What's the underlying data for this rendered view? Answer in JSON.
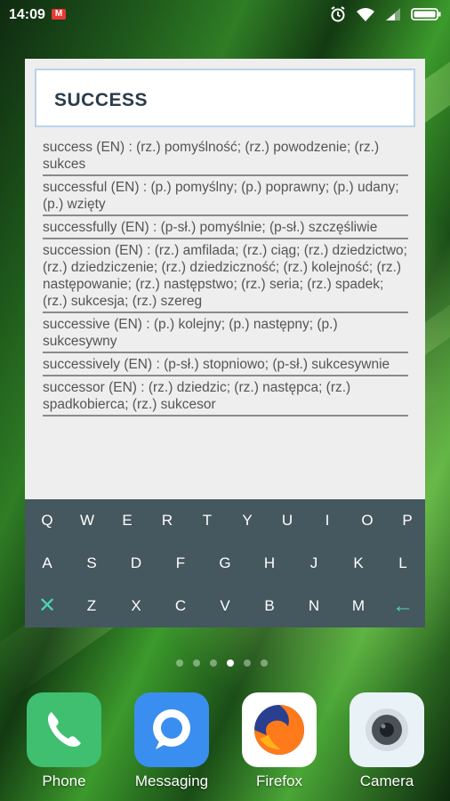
{
  "status_bar": {
    "time": "14:09",
    "mail_glyph": "M",
    "icons": [
      "alarm-icon",
      "wifi-icon",
      "signal-icon",
      "battery-icon"
    ]
  },
  "widget": {
    "search_value": "SUCCESS",
    "results": [
      "success (EN) : (rz.) pomyślność; (rz.) powodzenie; (rz.) sukces",
      "successful (EN) : (p.) pomyślny; (p.) poprawny; (p.) udany; (p.) wzięty",
      "successfully (EN) : (p-sł.) pomyślnie; (p-sł.) szczęśliwie",
      "succession (EN) : (rz.) amfilada; (rz.) ciąg; (rz.) dziedzictwo; (rz.) dziedziczenie; (rz.) dziedziczność; (rz.) kolejność; (rz.) następowanie; (rz.) następstwo; (rz.) seria; (rz.) spadek; (rz.) sukcesja; (rz.) szereg",
      "successive (EN) : (p.) kolejny; (p.) następny; (p.) sukcesywny",
      "successively (EN) : (p-sł.) stopniowo; (p-sł.) sukcesywnie",
      "successor (EN) : (rz.) dziedzic; (rz.) następca; (rz.) spadkobierca; (rz.) sukcesor"
    ]
  },
  "keyboard": {
    "row1": [
      "Q",
      "W",
      "E",
      "R",
      "T",
      "Y",
      "U",
      "I",
      "O",
      "P"
    ],
    "row2": [
      "A",
      "S",
      "D",
      "F",
      "G",
      "H",
      "J",
      "K",
      "L"
    ],
    "row3": [
      "Z",
      "X",
      "C",
      "V",
      "B",
      "N",
      "M"
    ],
    "clear_glyph": "✕",
    "backspace_glyph": "←"
  },
  "page_indicator": {
    "count": 6,
    "active_index": 3
  },
  "dock": [
    {
      "label": "Phone",
      "icon": "phone-icon",
      "color": "#3fbf6f"
    },
    {
      "label": "Messaging",
      "icon": "messaging-icon",
      "color": "#3a8ef0"
    },
    {
      "label": "Firefox",
      "icon": "firefox-icon",
      "color": "#ffffff"
    },
    {
      "label": "Camera",
      "icon": "camera-icon",
      "color": "#e9f2f7"
    }
  ]
}
